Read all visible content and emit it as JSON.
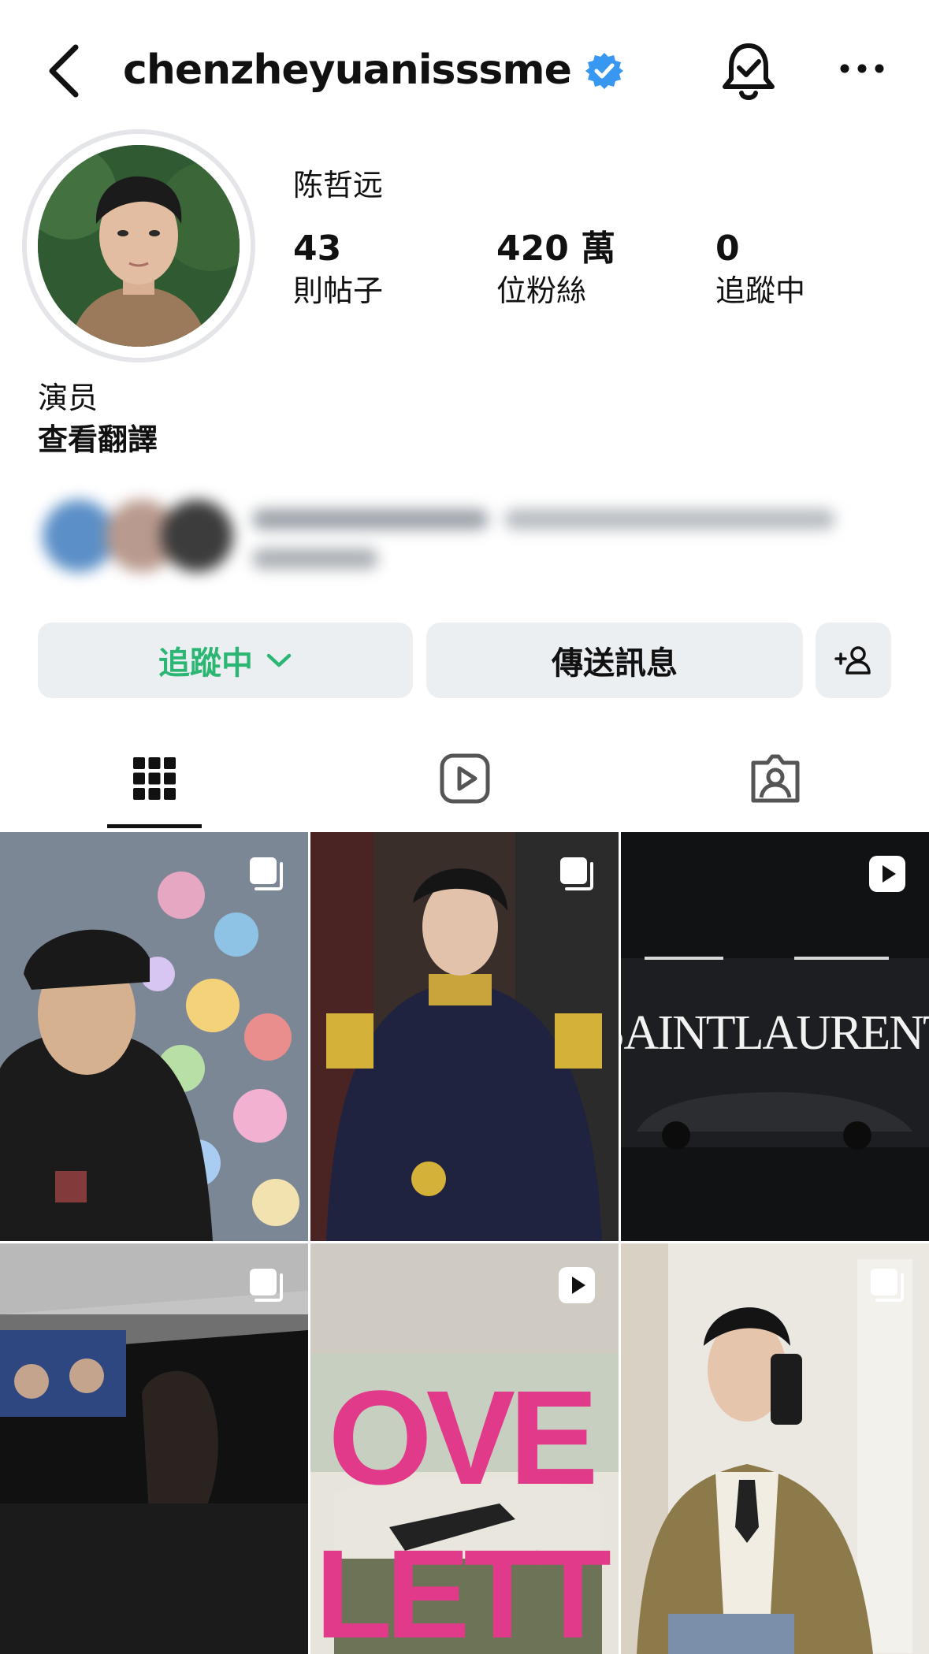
{
  "header": {
    "username": "chenzheyuanisssme",
    "verified": true,
    "icons": [
      "back-arrow-icon",
      "verified-badge-icon",
      "notification-bell-icon",
      "more-options-icon"
    ]
  },
  "profile": {
    "full_name": "陈哲远",
    "stats": [
      {
        "value": "43",
        "label": "則帖子"
      },
      {
        "value": "420 萬",
        "label": "位粉絲"
      },
      {
        "value": "0",
        "label": "追蹤中"
      }
    ],
    "bio": "演员",
    "translate_link": "查看翻譯"
  },
  "actions": {
    "follow_label": "追蹤中",
    "message_label": "傳送訊息",
    "follow_color": "#2bb673"
  },
  "tabs": [
    {
      "name": "posts",
      "icon": "grid-icon",
      "active": true
    },
    {
      "name": "reels",
      "icon": "reels-icon",
      "active": false
    },
    {
      "name": "tagged",
      "icon": "tagged-icon",
      "active": false
    }
  ],
  "posts": [
    {
      "type": "carousel",
      "badge_icon": "carousel-icon"
    },
    {
      "type": "carousel",
      "badge_icon": "carousel-icon"
    },
    {
      "type": "reel",
      "badge_icon": "reel-play-icon",
      "overlay_text": "SAINTLAURENT"
    },
    {
      "type": "carousel",
      "badge_icon": "carousel-icon"
    },
    {
      "type": "reel",
      "badge_icon": "reel-play-icon",
      "overlay_text": "OVE LETT"
    },
    {
      "type": "carousel",
      "badge_icon": "carousel-icon"
    }
  ],
  "colors": {
    "accent_green": "#2bb673",
    "verified_blue": "#3897f0",
    "button_bg": "#eceff2"
  }
}
